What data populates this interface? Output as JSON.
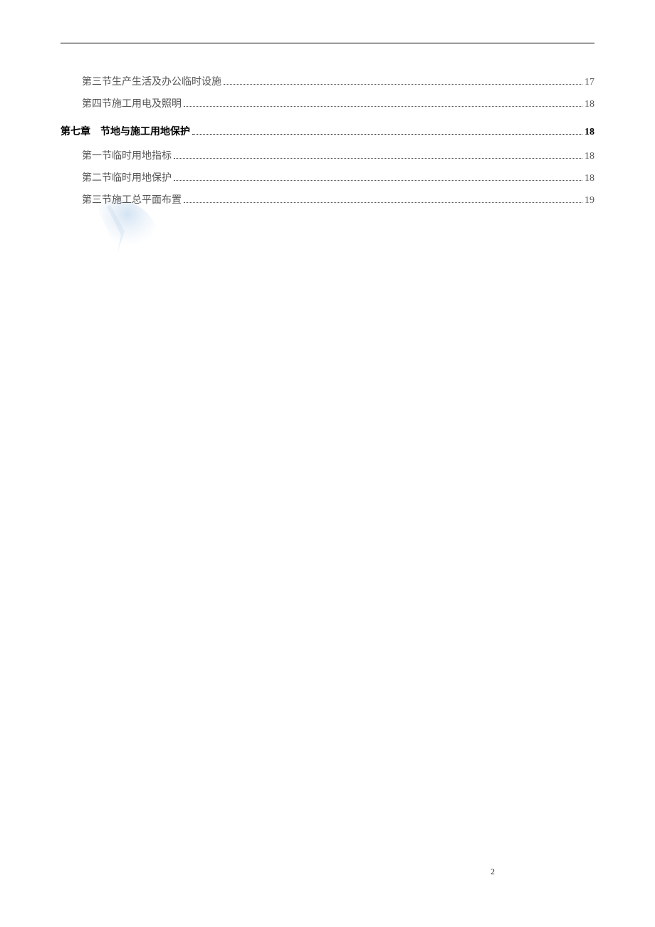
{
  "toc": {
    "entries": [
      {
        "type": "section",
        "label": "第三节",
        "title": "生产生活及办公临时设施",
        "page": "17"
      },
      {
        "type": "section",
        "label": "第四节",
        "title": "施工用电及照明",
        "page": "18"
      },
      {
        "type": "chapter",
        "label": "第七章",
        "title": "节地与施工用地保护",
        "page": "18"
      },
      {
        "type": "section",
        "label": "第一节",
        "title": "临时用地指标",
        "page": "18"
      },
      {
        "type": "section",
        "label": "第二节",
        "title": "临时用地保护",
        "page": "18"
      },
      {
        "type": "section",
        "label": "第三节",
        "title": "施工总平面布置",
        "page": "19"
      }
    ]
  },
  "pageNumber": "2"
}
